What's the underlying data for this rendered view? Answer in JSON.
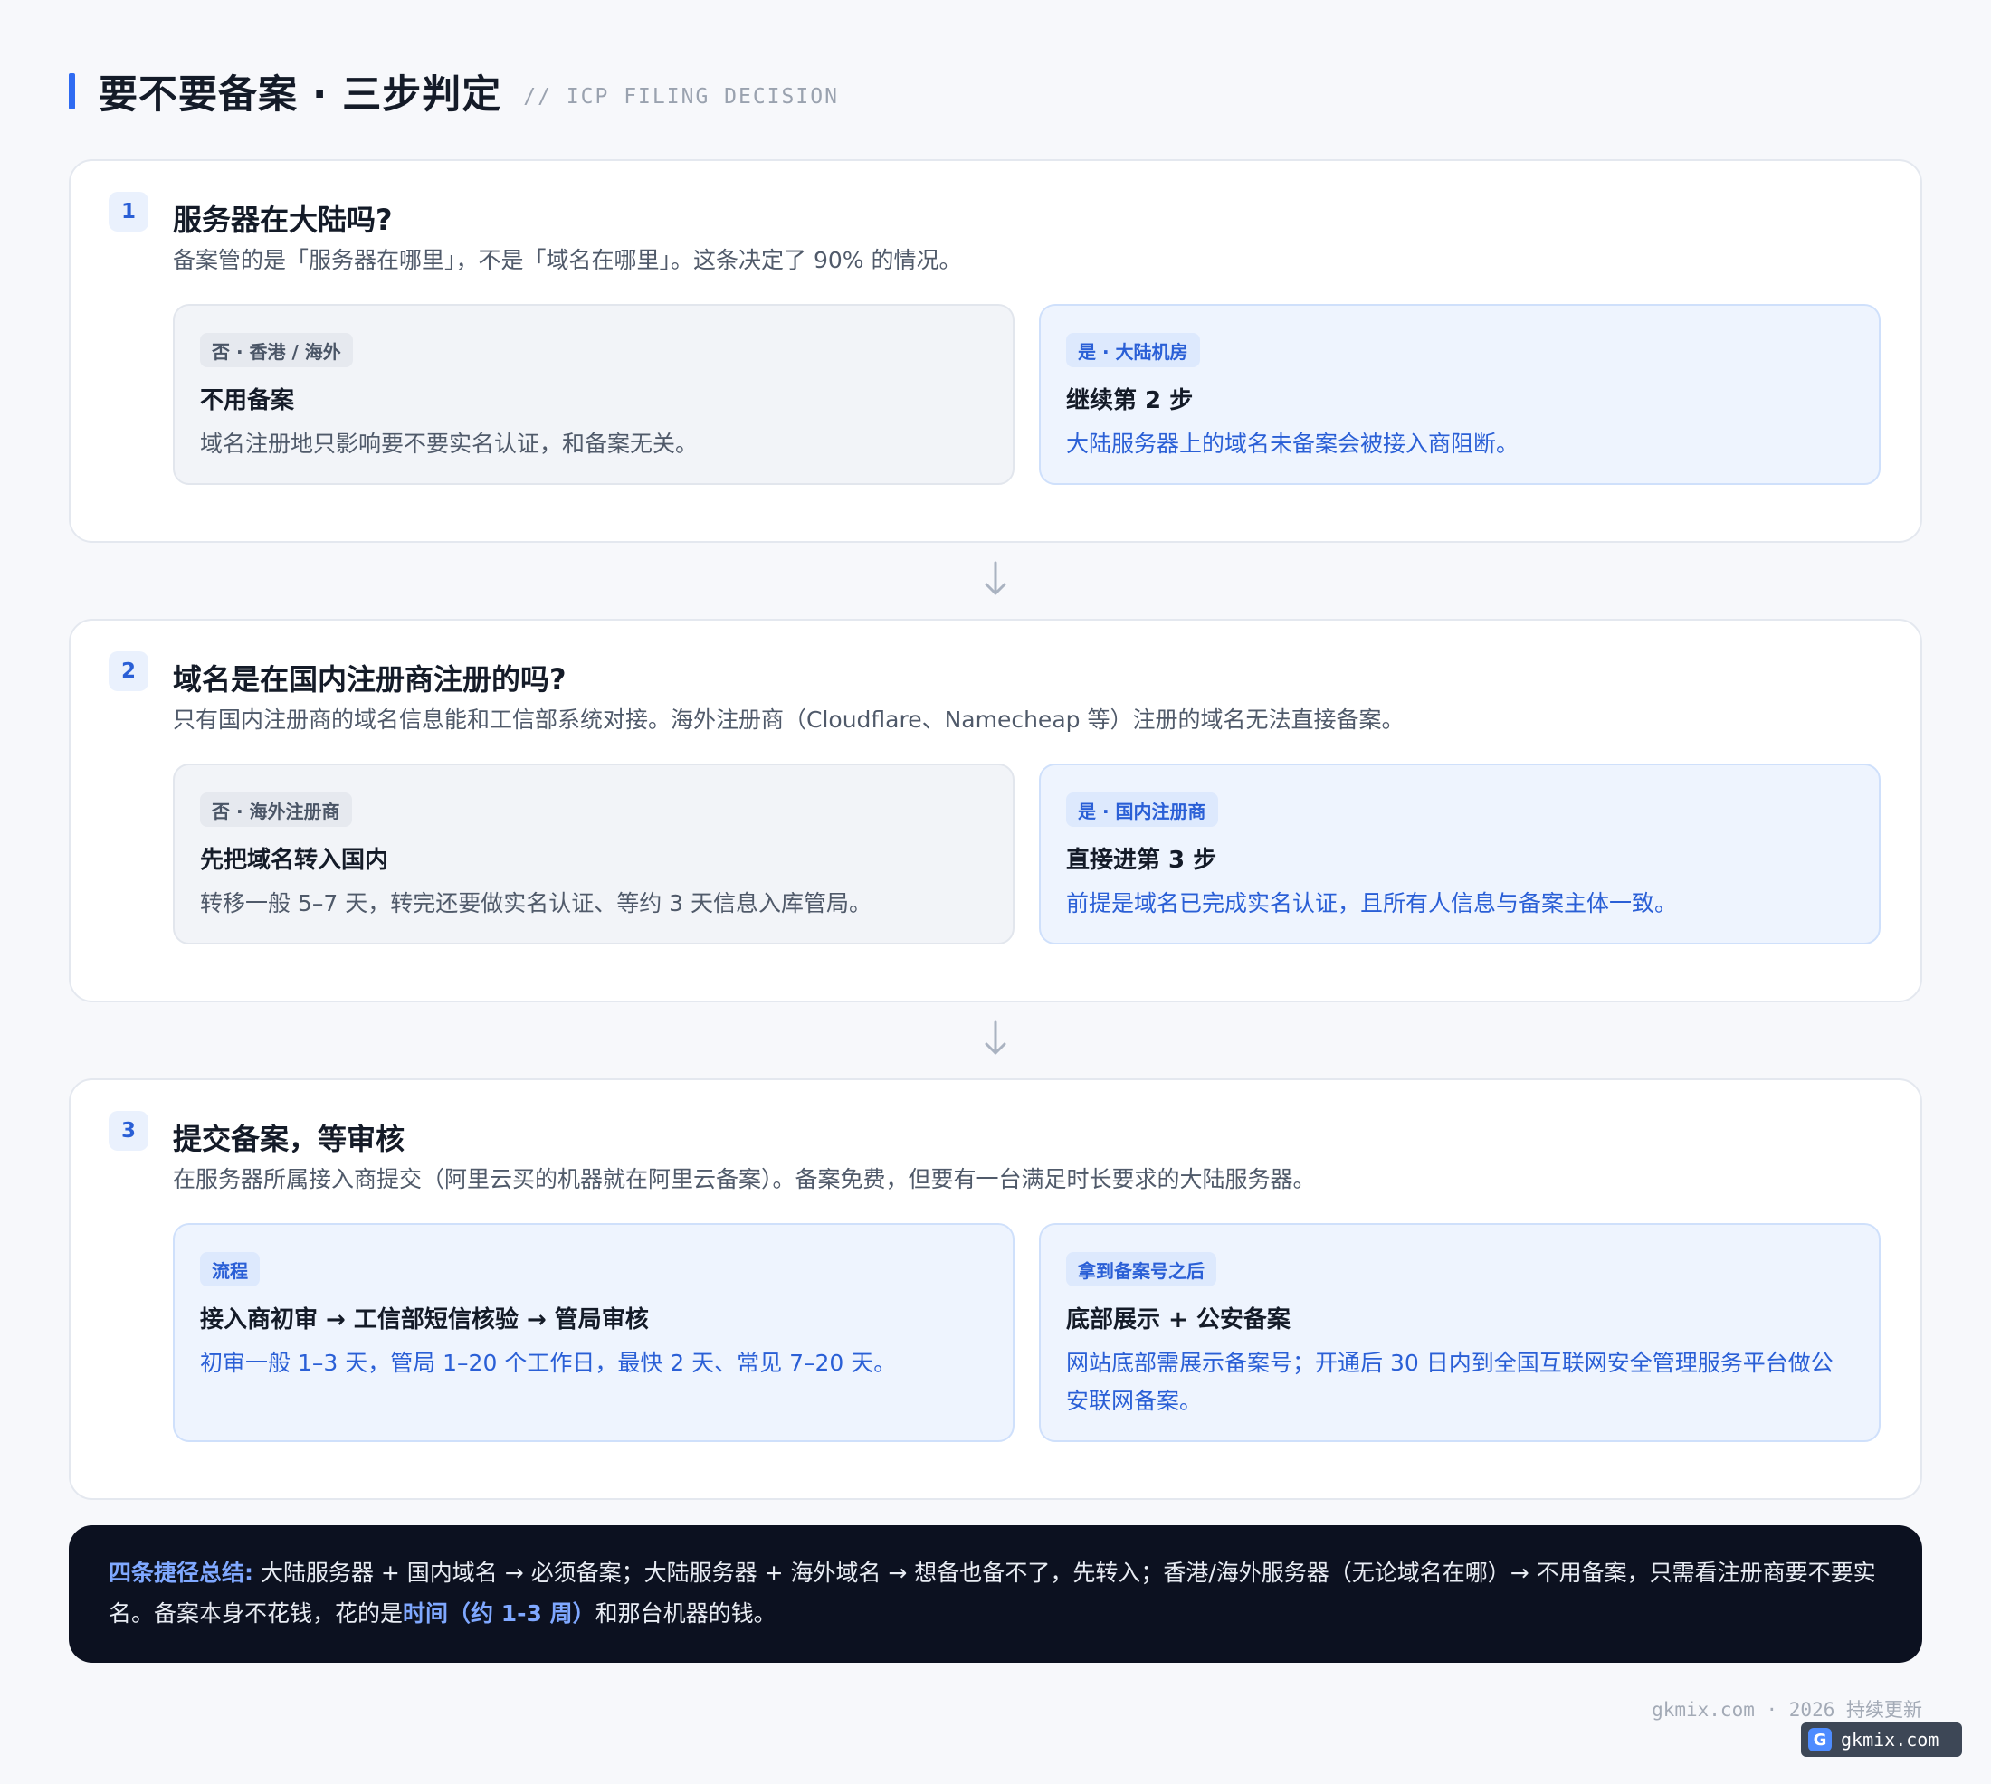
{
  "header": {
    "title": "要不要备案 · 三步判定",
    "subtitle": "// ICP FILING DECISION"
  },
  "steps": [
    {
      "number": "1",
      "question": "服务器在大陆吗?",
      "description": "备案管的是「服务器在哪里」，不是「域名在哪里」。这条决定了 90% 的情况。",
      "left": {
        "tag": "否 · 香港 / 海外",
        "title": "不用备案",
        "text": "域名注册地只影响要不要实名认证，和备案无关。"
      },
      "right": {
        "tag": "是 · 大陆机房",
        "title": "继续第 2 步",
        "text": "大陆服务器上的域名未备案会被接入商阻断。"
      }
    },
    {
      "number": "2",
      "question": "域名是在国内注册商注册的吗?",
      "description": "只有国内注册商的域名信息能和工信部系统对接。海外注册商（Cloudflare、Namecheap 等）注册的域名无法直接备案。",
      "left": {
        "tag": "否 · 海外注册商",
        "title": "先把域名转入国内",
        "text": "转移一般 5–7 天，转完还要做实名认证、等约 3 天信息入库管局。"
      },
      "right": {
        "tag": "是 · 国内注册商",
        "title": "直接进第 3 步",
        "text": "前提是域名已完成实名认证，且所有人信息与备案主体一致。"
      }
    },
    {
      "number": "3",
      "question": "提交备案，等审核",
      "description": "在服务器所属接入商提交（阿里云买的机器就在阿里云备案）。备案免费，但要有一台满足时长要求的大陆服务器。",
      "left": {
        "tag": "流程",
        "title": "接入商初审 → 工信部短信核验 → 管局审核",
        "text": "初审一般 1–3 天，管局 1–20 个工作日，最快 2 天、常见 7–20 天。"
      },
      "right": {
        "tag": "拿到备案号之后",
        "title": "底部展示 + 公安备案",
        "text": "网站底部需展示备案号；开通后 30 日内到全国互联网安全管理服务平台做公安联网备案。"
      }
    }
  ],
  "summary": {
    "lead": "四条捷径总结:",
    "text1": " 大陆服务器 + 国内域名 → 必须备案；大陆服务器 + 海外域名 → 想备也备不了，先转入；香港/海外服务器（无论域名在哪）→ 不用备案，只需看注册商要不要实名。备案本身不花钱，花的是",
    "highlight": "时间（约 1-3 周）",
    "text2": "和那台机器的钱。"
  },
  "footer": "gkmix.com · 2026 持续更新",
  "watermark": {
    "logo": "G",
    "text": "gkmix.com"
  },
  "colors": {
    "accent": "#2f6bf2",
    "yes_text": "#2a5fd6",
    "summary_bg": "#0c1120"
  }
}
